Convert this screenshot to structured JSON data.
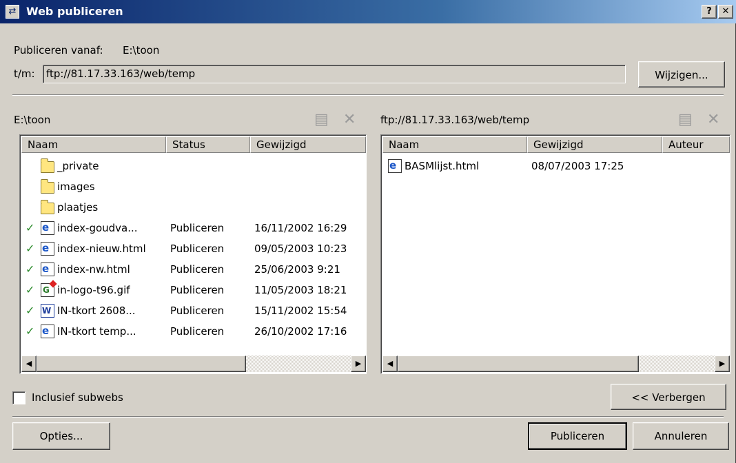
{
  "window": {
    "title": "Web publiceren",
    "help_label": "?",
    "close_label": "✕"
  },
  "source": {
    "label": "Publiceren vanaf:",
    "value": "E:\\toon"
  },
  "destination": {
    "label": "t/m:",
    "value": "ftp://81.17.33.163/web/temp",
    "change_label": "Wijzigen..."
  },
  "left_panel": {
    "path": "E:\\toon",
    "columns": [
      "Naam",
      "Status",
      "Gewijzigd"
    ],
    "rows": [
      {
        "icon": "folder-icon",
        "checked": false,
        "name": "_private",
        "status": "",
        "modified": ""
      },
      {
        "icon": "folder-icon",
        "checked": false,
        "name": "images",
        "status": "",
        "modified": ""
      },
      {
        "icon": "folder-icon",
        "checked": false,
        "name": "plaatjes",
        "status": "",
        "modified": ""
      },
      {
        "icon": "html-file-icon",
        "checked": true,
        "name": "index-goudva...",
        "status": "Publiceren",
        "modified": "16/11/2002 16:29"
      },
      {
        "icon": "html-file-icon",
        "checked": true,
        "name": "index-nieuw.html",
        "status": "Publiceren",
        "modified": "09/05/2003 10:23"
      },
      {
        "icon": "html-file-icon",
        "checked": true,
        "name": "index-nw.html",
        "status": "Publiceren",
        "modified": "25/06/2003 9:21"
      },
      {
        "icon": "gif-file-icon",
        "checked": true,
        "name": "in-logo-t96.gif",
        "status": "Publiceren",
        "modified": "11/05/2003 18:21"
      },
      {
        "icon": "word-file-icon",
        "checked": true,
        "name": "IN-tkort 2608...",
        "status": "Publiceren",
        "modified": "15/11/2002 15:54"
      },
      {
        "icon": "html-file-icon",
        "checked": true,
        "name": "IN-tkort temp...",
        "status": "Publiceren",
        "modified": "26/10/2002 17:16"
      }
    ]
  },
  "right_panel": {
    "path": "ftp://81.17.33.163/web/temp",
    "columns": [
      "Naam",
      "Gewijzigd",
      "Auteur"
    ],
    "rows": [
      {
        "icon": "html-file-icon",
        "name": "BASMlijst.html",
        "modified": "08/07/2003 17:25",
        "author": ""
      }
    ]
  },
  "glyphs": {
    "check": "✓",
    "delete": "✕",
    "folder_up": "▤",
    "arrow_left": "◀",
    "arrow_right": "▶",
    "html_mark": "e",
    "gif_mark": "G",
    "word_mark": "W"
  },
  "options": {
    "include_subwebs_label": "Inclusief subwebs",
    "include_subwebs_checked": false,
    "hide_label": "<< Verbergen"
  },
  "footer": {
    "options_label": "Opties...",
    "publish_label": "Publiceren",
    "cancel_label": "Annuleren"
  },
  "colors": {
    "title_start": "#0a246a",
    "title_end": "#a6caf0",
    "face": "#d4d0c8",
    "check": "#2a8a2a"
  }
}
